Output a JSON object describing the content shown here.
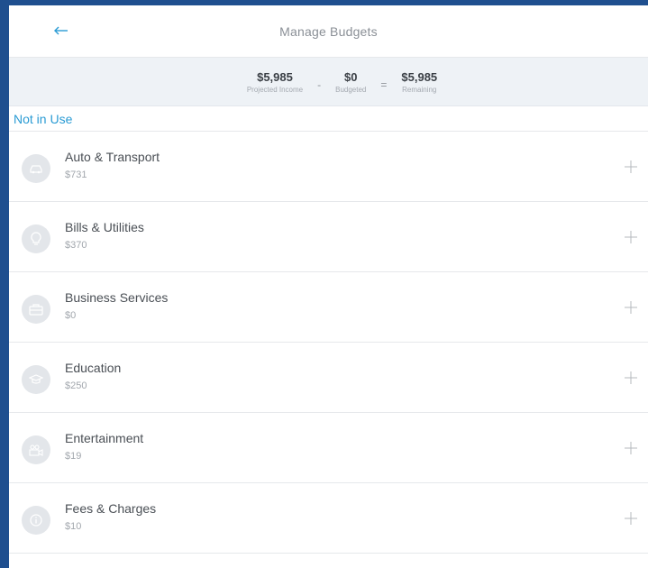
{
  "header": {
    "back_icon": "arrow-left-icon",
    "title": "Manage Budgets"
  },
  "summary": {
    "projected_income": {
      "value": "$5,985",
      "label": "Projected Income"
    },
    "minus": "-",
    "budgeted": {
      "value": "$0",
      "label": "Budgeted"
    },
    "equals": "=",
    "remaining": {
      "value": "$5,985",
      "label": "Remaining"
    }
  },
  "section": {
    "title": "Not in Use"
  },
  "categories": [
    {
      "name": "Auto & Transport",
      "amount": "$731",
      "icon": "car-icon"
    },
    {
      "name": "Bills & Utilities",
      "amount": "$370",
      "icon": "lightbulb-icon"
    },
    {
      "name": "Business Services",
      "amount": "$0",
      "icon": "briefcase-icon"
    },
    {
      "name": "Education",
      "amount": "$250",
      "icon": "graduation-cap-icon"
    },
    {
      "name": "Entertainment",
      "amount": "$19",
      "icon": "film-camera-icon"
    },
    {
      "name": "Fees & Charges",
      "amount": "$10",
      "icon": "info-icon"
    }
  ],
  "colors": {
    "accent": "#2a9bd4",
    "summary_bg": "#eef2f6",
    "frame": "#1f4f8f",
    "icon_bg": "#e3e6ea"
  }
}
